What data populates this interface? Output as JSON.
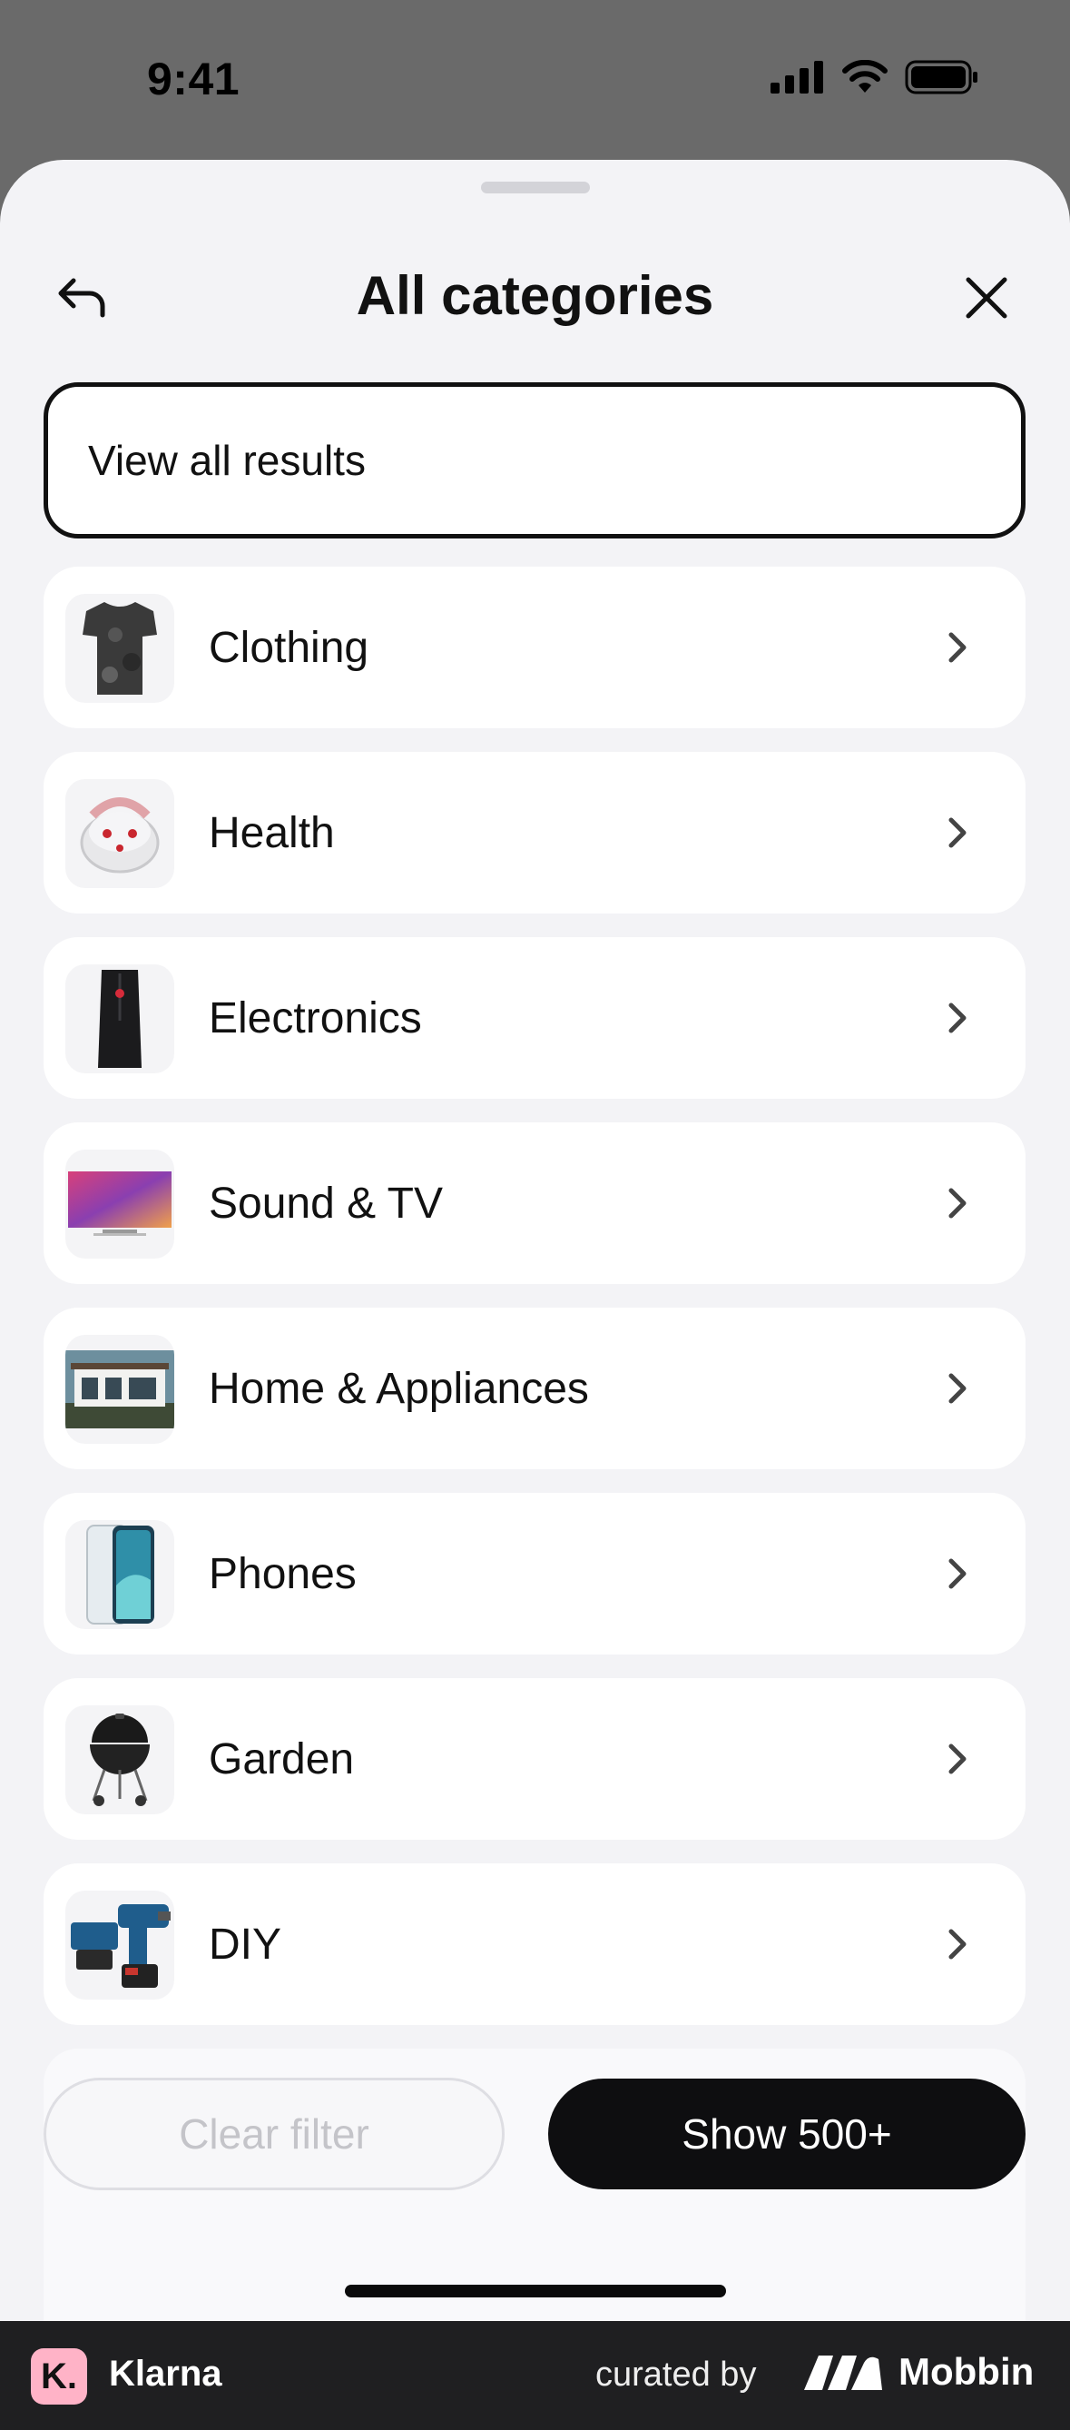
{
  "status_bar": {
    "time": "9:41"
  },
  "sheet": {
    "title": "All categories",
    "view_all_label": "View all results",
    "categories": [
      {
        "label": "Clothing",
        "icon": "tshirt-image"
      },
      {
        "label": "Health",
        "icon": "foot-spa-image"
      },
      {
        "label": "Electronics",
        "icon": "pc-tower-image"
      },
      {
        "label": "Sound & TV",
        "icon": "tv-image"
      },
      {
        "label": "Home & Appliances",
        "icon": "garden-house-image"
      },
      {
        "label": "Phones",
        "icon": "smartphone-image"
      },
      {
        "label": "Garden",
        "icon": "grill-image"
      },
      {
        "label": "DIY",
        "icon": "power-drill-image"
      }
    ]
  },
  "footer": {
    "clear_label": "Clear filter",
    "show_label": "Show 500+"
  },
  "branding": {
    "app_name": "Klarna",
    "logo_letter": "K.",
    "curated_by": "curated by",
    "curator": "Mobbin"
  },
  "colors": {
    "accent_dark": "#0e0e10",
    "klarna_pink": "#ffb3c7",
    "sheet_bg": "#f3f3f6"
  }
}
